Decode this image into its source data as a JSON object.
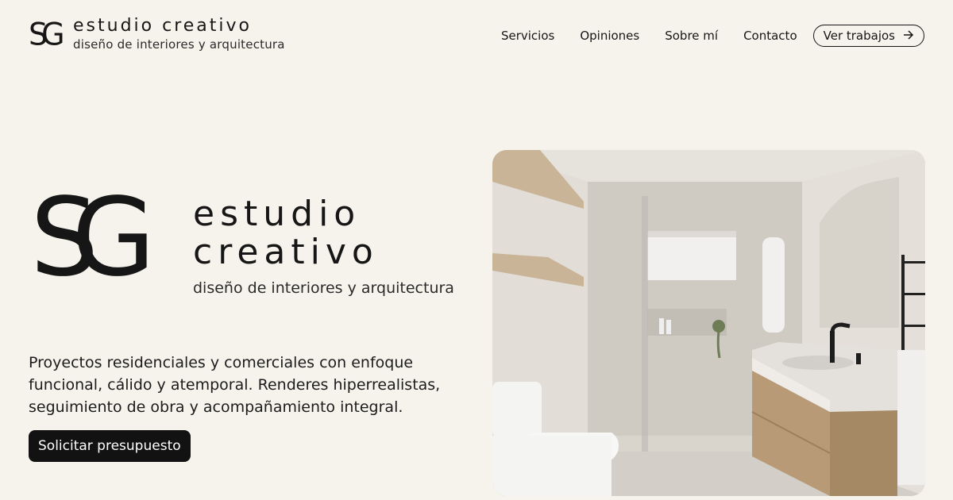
{
  "brand": {
    "monogram": "SG",
    "name": "estudio creativo",
    "tagline": "diseño de interiores y arquitectura"
  },
  "nav": {
    "items": [
      "Servicios",
      "Opiniones",
      "Sobre mí",
      "Contacto"
    ],
    "cta_label": "Ver trabajos",
    "cta_icon": "arrow-right-icon"
  },
  "hero": {
    "monogram": "SG",
    "name_line1": "estudio",
    "name_line2": "creativo",
    "tagline": "diseño de interiores y arquitectura",
    "description": "Proyectos residenciales y comerciales con enfoque funcional, cálido y atemporal. Renderes hiperrealistas, seguimiento de obra y acompañamiento integral.",
    "cta_label": "Solicitar presupuesto"
  },
  "colors": {
    "background": "#f6f3ec",
    "text": "#161616",
    "button": "#121212"
  }
}
